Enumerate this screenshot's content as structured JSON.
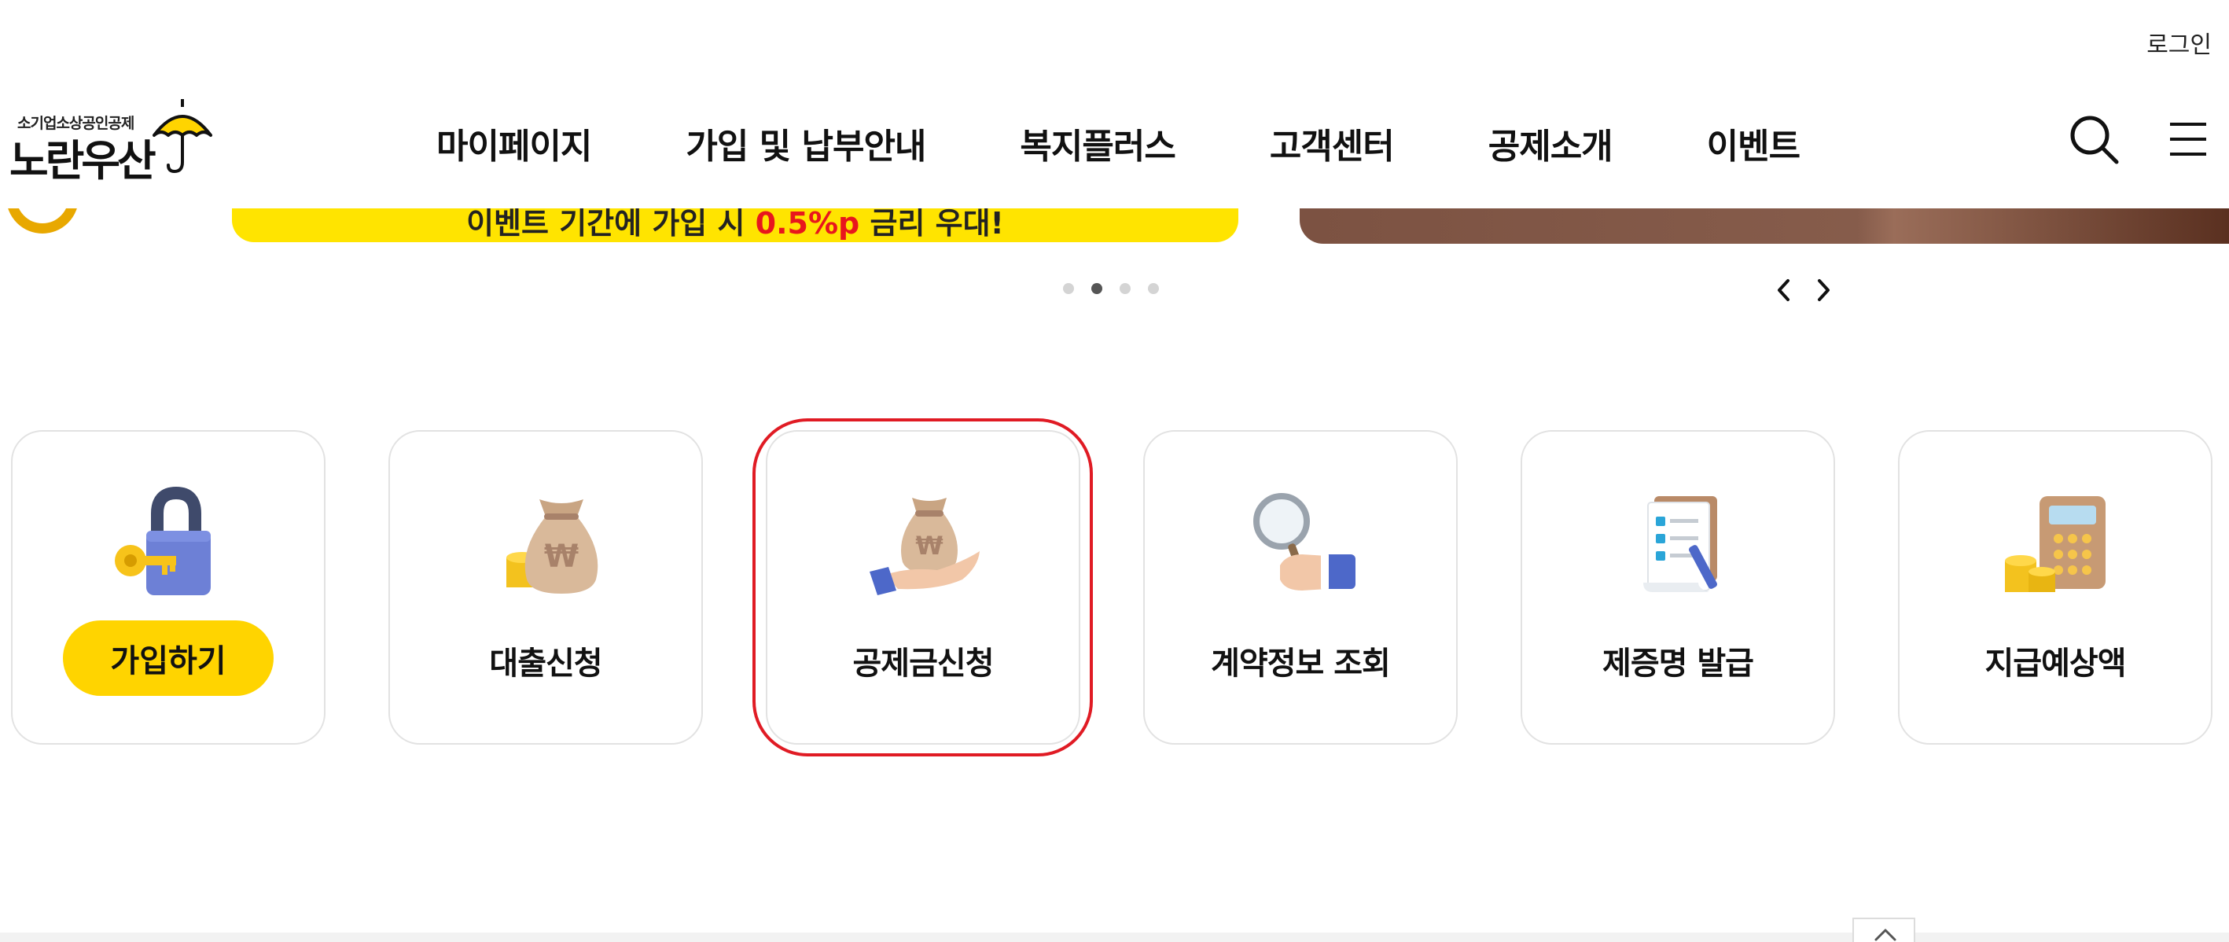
{
  "header": {
    "login_label": "로그인",
    "logo": {
      "sub": "소기업소상공인공제",
      "main": "노란우산"
    },
    "nav": [
      "마이페이지",
      "가입 및 납부안내",
      "복지플러스",
      "고객센터",
      "공제소개",
      "이벤트"
    ]
  },
  "banner": {
    "text_before": "이벤트 기간에 가입 시 ",
    "text_highlight": "0.5%p",
    "text_after": " 금리 우대!",
    "slide_count": 4,
    "active_slide": 2
  },
  "quick_menu": {
    "join_button": "가입하기",
    "items": [
      {
        "label": "대출신청",
        "icon": "money-bag-icon"
      },
      {
        "label": "공제금신청",
        "icon": "hand-money-bag-icon"
      },
      {
        "label": "계약정보 조회",
        "icon": "magnifier-hand-icon"
      },
      {
        "label": "제증명 발급",
        "icon": "checklist-icon"
      },
      {
        "label": "지급예상액",
        "icon": "calculator-icon"
      }
    ]
  },
  "colors": {
    "brand_yellow": "#ffd400",
    "banner_yellow": "#ffe400",
    "highlight_red": "#e01b24",
    "card_border": "#e2e2e2"
  }
}
